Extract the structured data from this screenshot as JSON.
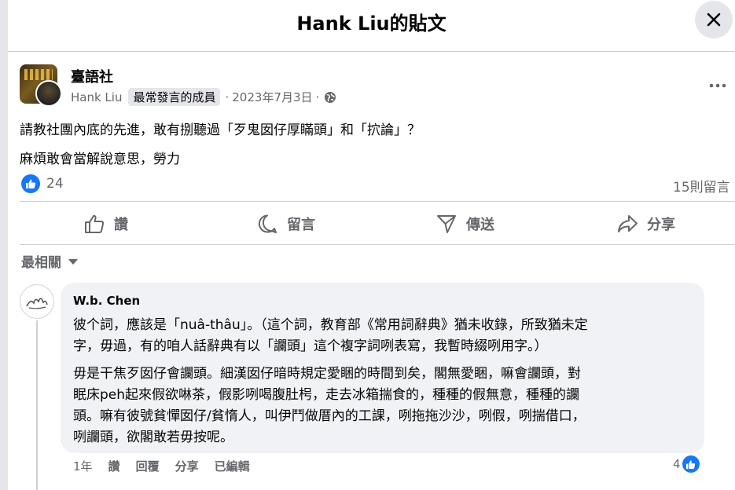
{
  "dialog": {
    "title": "Hank Liu的貼文"
  },
  "post": {
    "group_name": "臺語社",
    "author": "Hank Liu",
    "badge": "最常發言的成員",
    "separator": "·",
    "date": "2023年7月3日",
    "separator2": "·",
    "text_line1": "請教社團內底的先進，敢有捌聽過「歹鬼囡仔厚瞞頭」和「㧒論」？",
    "text_line2": "麻煩敢會當解說意思，勞力",
    "likes": "24",
    "comments": "15則留言",
    "accent_color": "#1877f2"
  },
  "actions": {
    "like": "讚",
    "comment": "留言",
    "send": "傳送",
    "share": "分享"
  },
  "sort": {
    "label": "最相關"
  },
  "comment": {
    "author": "W.b. Chen",
    "line1": "彼个詞，應該是「nuâ-thâu」。（這个詞，教育部《常用詞辭典》猶未收錄，所致猶未定",
    "line2": "字，毋過，有的咱人話辭典有以「讕頭」這个複字詞咧表寫，我暫時綴咧用字。）",
    "line3": "毋是干焦歹囡仔會讕頭。細漢囡仔暗時規定愛睏的時間到矣，閣無愛睏，嘛會讕頭，對",
    "line4": "眠床peh起來假欲啉茶，假影咧喝腹肚枵，走去冰箱揣食的，種種的假無意，種種的讕",
    "line5": "頭。嘛有彼號貧憚囡仔/貧惰人，叫伊鬥做厝內的工課，咧拖拖沙沙，咧假，咧揣借口，",
    "line6": "咧讕頭，欲閣敢若毋按呢。",
    "time": "1年",
    "like": "讚",
    "reply": "回覆",
    "share": "分享",
    "edited": "已編輯",
    "likes": "4"
  }
}
